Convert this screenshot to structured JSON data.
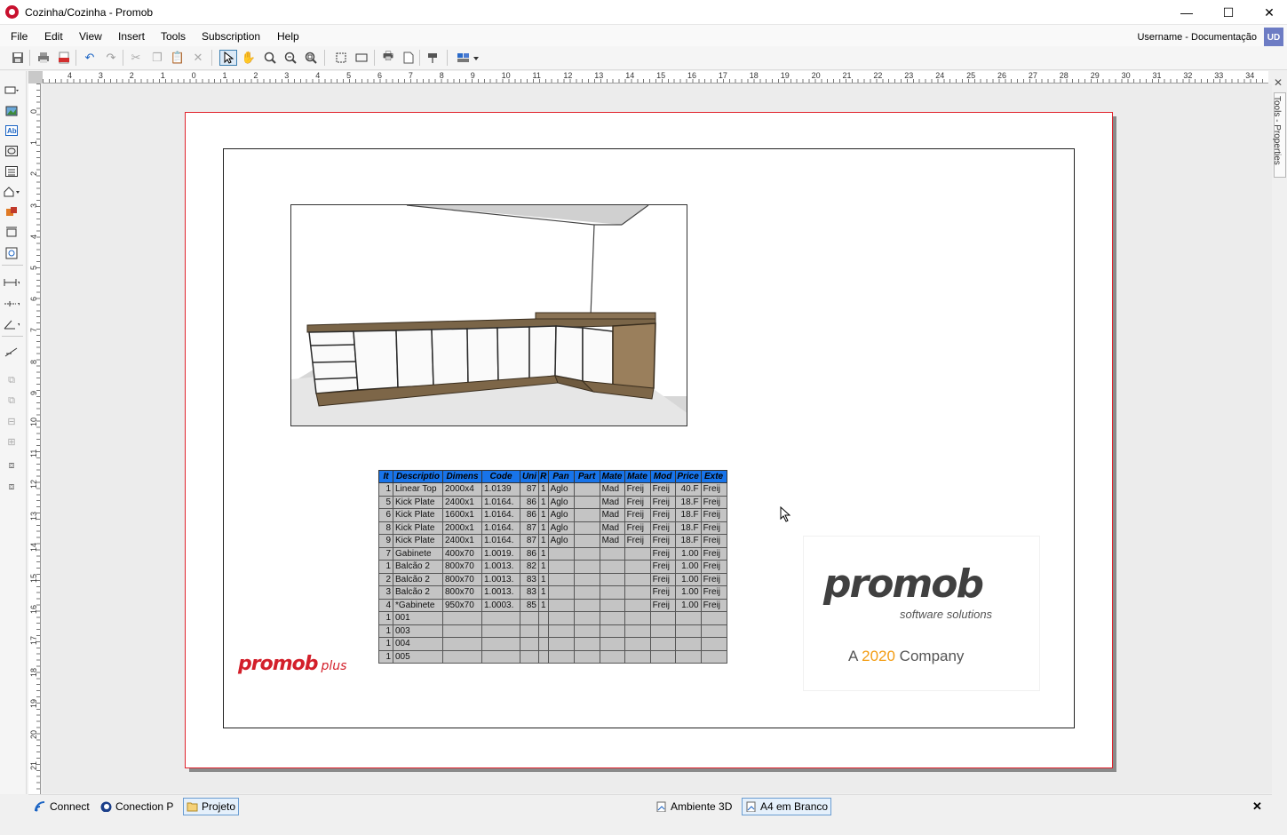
{
  "window": {
    "title": "Cozinha/Cozinha - Promob",
    "minimize": "—",
    "maximize": "☐",
    "close": "✕"
  },
  "menu": [
    "File",
    "Edit",
    "View",
    "Insert",
    "Tools",
    "Subscription",
    "Help"
  ],
  "user": {
    "label": "Username - Documentação",
    "initials": "UD"
  },
  "ruler": {
    "h_ticks": [
      "4",
      "3",
      "2",
      "1",
      "0",
      "1",
      "2",
      "3",
      "4",
      "5",
      "6",
      "7",
      "8",
      "9",
      "10",
      "11",
      "12",
      "13",
      "14",
      "15",
      "16",
      "17",
      "18",
      "19",
      "20",
      "21",
      "22",
      "23",
      "24",
      "25",
      "26",
      "27",
      "28",
      "29",
      "30",
      "31",
      "32",
      "33",
      "34"
    ],
    "v_ticks": [
      "0",
      "1",
      "2",
      "3",
      "4",
      "5",
      "6",
      "7",
      "8",
      "9",
      "10",
      "11",
      "12",
      "13",
      "14",
      "15",
      "16",
      "17",
      "18",
      "19",
      "20",
      "21"
    ]
  },
  "side_panel": {
    "label": "Tools - Properties",
    "close": "✕"
  },
  "table": {
    "headers": [
      "It",
      "Descriptio",
      "Dimens",
      "Code",
      "Uni",
      "R",
      "Pan",
      "Part",
      "Mate",
      "Mate",
      "Mod",
      "Price",
      "Exte"
    ],
    "rows": [
      [
        "1",
        "Linear Top",
        "2000x4",
        "1.0139",
        "87",
        "1",
        "Aglo",
        "",
        "Mad",
        "Freij",
        "Freij",
        "40.F",
        "Freij"
      ],
      [
        "5",
        "Kick Plate",
        "2400x1",
        "1.0164.",
        "86",
        "1",
        "Aglo",
        "",
        "Mad",
        "Freij",
        "Freij",
        "18.F",
        "Freij"
      ],
      [
        "6",
        "Kick Plate",
        "1600x1",
        "1.0164.",
        "86",
        "1",
        "Aglo",
        "",
        "Mad",
        "Freij",
        "Freij",
        "18.F",
        "Freij"
      ],
      [
        "8",
        "Kick Plate",
        "2000x1",
        "1.0164.",
        "87",
        "1",
        "Aglo",
        "",
        "Mad",
        "Freij",
        "Freij",
        "18.F",
        "Freij"
      ],
      [
        "9",
        "Kick Plate",
        "2400x1",
        "1.0164.",
        "87",
        "1",
        "Aglo",
        "",
        "Mad",
        "Freij",
        "Freij",
        "18.F",
        "Freij"
      ],
      [
        "7",
        "Gabinete",
        "400x70",
        "1.0019.",
        "86",
        "1",
        "",
        "",
        "",
        "",
        "Freij",
        "1.00",
        "Freij"
      ],
      [
        "1",
        "Balcão 2",
        "800x70",
        "1.0013.",
        "82",
        "1",
        "",
        "",
        "",
        "",
        "Freij",
        "1.00",
        "Freij"
      ],
      [
        "2",
        "Balcão 2",
        "800x70",
        "1.0013.",
        "83",
        "1",
        "",
        "",
        "",
        "",
        "Freij",
        "1.00",
        "Freij"
      ],
      [
        "3",
        "Balcão 2",
        "800x70",
        "1.0013.",
        "83",
        "1",
        "",
        "",
        "",
        "",
        "Freij",
        "1.00",
        "Freij"
      ],
      [
        "4",
        "*Gabinete",
        "950x70",
        "1.0003.",
        "85",
        "1",
        "",
        "",
        "",
        "",
        "Freij",
        "1.00",
        "Freij"
      ],
      [
        "1",
        "001",
        "",
        "",
        "",
        "",
        "",
        "",
        "",
        "",
        "",
        "",
        ""
      ],
      [
        "1",
        "003",
        "",
        "",
        "",
        "",
        "",
        "",
        "",
        "",
        "",
        "",
        ""
      ],
      [
        "1",
        "004",
        "",
        "",
        "",
        "",
        "",
        "",
        "",
        "",
        "",
        "",
        ""
      ],
      [
        "1",
        "005",
        "",
        "",
        "",
        "",
        "",
        "",
        "",
        "",
        "",
        "",
        ""
      ]
    ]
  },
  "logos": {
    "plus_word": "promob",
    "plus_suffix": "plus",
    "big_word": "promob",
    "big_sub": "software solutions",
    "company_prefix": "A ",
    "company_num": "2020",
    "company_suffix": " Company"
  },
  "statusbar": {
    "left_tabs": [
      "Connect",
      "Conection P",
      "Projeto"
    ],
    "right_tabs": [
      "Ambiente 3D",
      "A4 em Branco"
    ],
    "close": "✕"
  },
  "colors": {
    "accent": "#1874ea",
    "page_border": "#e0212b",
    "brand_red": "#d31f2a"
  }
}
